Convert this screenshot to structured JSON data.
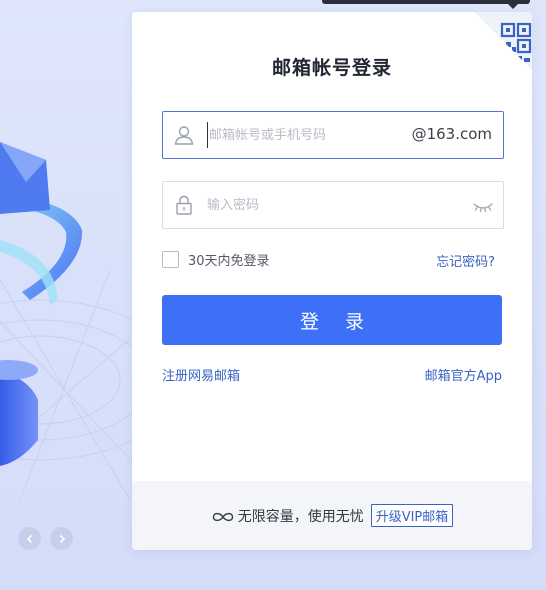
{
  "card": {
    "title": "邮箱帐号登录"
  },
  "account": {
    "placeholder": "邮箱帐号或手机号码",
    "value": "",
    "suffix": "@163.com"
  },
  "password": {
    "placeholder": "输入密码",
    "value": ""
  },
  "remember": {
    "label": "30天内免登录",
    "checked": false
  },
  "forgot_label": "忘记密码?",
  "login_label": "登 录",
  "links": {
    "register": "注册网易邮箱",
    "app": "邮箱官方App"
  },
  "footer": {
    "text": "无限容量，使用无忧",
    "vip_label": "升级VIP邮箱"
  },
  "icons": {
    "qr": "qr-code-icon",
    "user": "user-icon",
    "lock": "lock-icon",
    "eye": "eye-closed-icon",
    "infinity": "infinity-icon",
    "prev": "chevron-left-icon",
    "next": "chevron-right-icon"
  },
  "colors": {
    "accent": "#3d70f6",
    "link": "#3a62c4",
    "background": "#dfe6fb"
  }
}
